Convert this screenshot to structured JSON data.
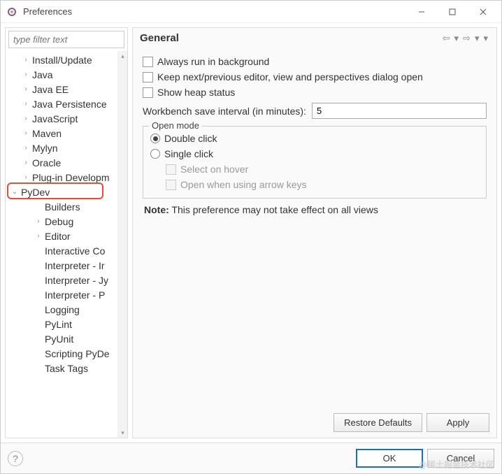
{
  "window": {
    "title": "Preferences"
  },
  "sidebar": {
    "filter_placeholder": "type filter text",
    "items": [
      {
        "label": "Install/Update",
        "indent": 1,
        "expander": "right"
      },
      {
        "label": "Java",
        "indent": 1,
        "expander": "right"
      },
      {
        "label": "Java EE",
        "indent": 1,
        "expander": "right"
      },
      {
        "label": "Java Persistence",
        "indent": 1,
        "expander": "right"
      },
      {
        "label": "JavaScript",
        "indent": 1,
        "expander": "right"
      },
      {
        "label": "Maven",
        "indent": 1,
        "expander": "right"
      },
      {
        "label": "Mylyn",
        "indent": 1,
        "expander": "right"
      },
      {
        "label": "Oracle",
        "indent": 1,
        "expander": "right"
      },
      {
        "label": "Plug-in Developm",
        "indent": 1,
        "expander": "right"
      },
      {
        "label": "PyDev",
        "indent": 0,
        "expander": "down",
        "highlight": true
      },
      {
        "label": "Builders",
        "indent": 2,
        "expander": "none"
      },
      {
        "label": "Debug",
        "indent": 2,
        "expander": "right"
      },
      {
        "label": "Editor",
        "indent": 2,
        "expander": "right"
      },
      {
        "label": "Interactive Co",
        "indent": 2,
        "expander": "none"
      },
      {
        "label": "Interpreter - Ir",
        "indent": 2,
        "expander": "none"
      },
      {
        "label": "Interpreter - Jy",
        "indent": 2,
        "expander": "none"
      },
      {
        "label": "Interpreter - P",
        "indent": 2,
        "expander": "none"
      },
      {
        "label": "Logging",
        "indent": 2,
        "expander": "none"
      },
      {
        "label": "PyLint",
        "indent": 2,
        "expander": "none"
      },
      {
        "label": "PyUnit",
        "indent": 2,
        "expander": "none"
      },
      {
        "label": "Scripting PyDe",
        "indent": 2,
        "expander": "none"
      },
      {
        "label": "Task Tags",
        "indent": 2,
        "expander": "none"
      }
    ]
  },
  "content": {
    "title": "General",
    "check_background": "Always run in background",
    "check_keep_dialog": "Keep next/previous editor, view and perspectives dialog open",
    "check_heap": "Show heap status",
    "interval_label": "Workbench save interval (in minutes):",
    "interval_value": "5",
    "openmode": {
      "title": "Open mode",
      "double_click": "Double click",
      "single_click": "Single click",
      "select_hover": "Select on hover",
      "open_arrow": "Open when using arrow keys"
    },
    "note_label": "Note:",
    "note_text": "This preference may not take effect on all views",
    "restore_defaults": "Restore Defaults",
    "apply": "Apply"
  },
  "footer": {
    "ok": "OK",
    "cancel": "Cancel"
  },
  "watermark": "@稀土掘金技术社区"
}
